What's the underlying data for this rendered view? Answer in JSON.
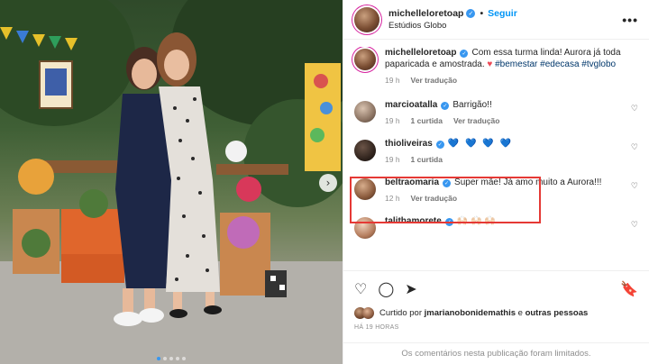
{
  "post": {
    "author": "michelleloretoap",
    "follow_label": "Seguir",
    "separator": "•",
    "location": "Estúdios Globo",
    "more_label": "•••",
    "caption": {
      "text": "Com essa turma linda! Aurora já toda paparicada e amostrada.",
      "heart": "♥",
      "hashtags": "#bemestar #edecasa #tvglobo",
      "time": "19 h",
      "translate_label": "Ver tradução"
    }
  },
  "comments": [
    {
      "user": "marcioatalla",
      "text": "Barrigão!!",
      "time": "19 h",
      "likes": "1 curtida",
      "translate": "Ver tradução"
    },
    {
      "user": "thioliveiras",
      "text": "💙 💙 💙 💙",
      "time": "19 h",
      "likes": "1 curtida"
    },
    {
      "user": "beltraomaria",
      "text": "Super mãe! Já amo muito a Aurora!!!",
      "time": "12 h",
      "translate": "Ver tradução"
    },
    {
      "user": "talithamorete",
      "text": "🙌🏻 🙌🏻 🙌🏻"
    }
  ],
  "footer": {
    "liked_prefix": "Curtido por",
    "liked_user": "jmarianobonidemathis",
    "liked_middle": "e",
    "liked_others": "outras pessoas",
    "time_ago": "HÁ 19 HORAS",
    "limited_text": "Os comentários nesta publicação foram limitados."
  },
  "icons": {
    "verified": "✓",
    "like": "♡",
    "comment": "◯",
    "share": "➤",
    "bookmark": "🔖",
    "next": "›"
  },
  "colors": {
    "link_blue": "#0095f6",
    "hashtag": "#00376b",
    "highlight_border": "#e53935"
  }
}
